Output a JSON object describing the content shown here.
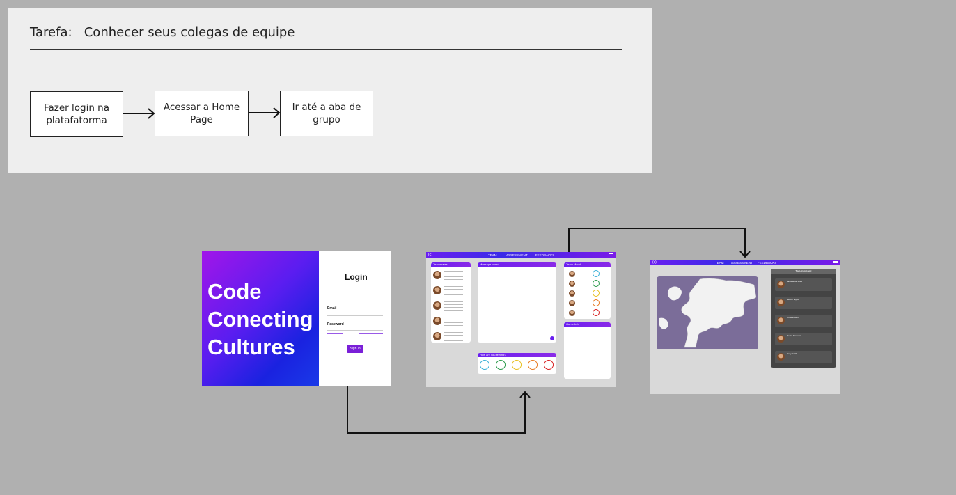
{
  "task": {
    "label": "Tarefa:",
    "text": "Conhecer seus colegas de equipe"
  },
  "steps": [
    {
      "text": "Fazer login na platafatorma"
    },
    {
      "text": "Acessar a Home Page"
    },
    {
      "text": "Ir até a aba de grupo"
    }
  ],
  "login_screen": {
    "hero_lines": [
      "Code",
      "Conecting",
      "Cultures"
    ],
    "title": "Login",
    "email_label": "Email",
    "password_label": "Password",
    "button_label": "Sign in",
    "colors": {
      "hero_start": "#a116e9",
      "hero_end": "#1a3ae8",
      "button": "#7a1fd8"
    }
  },
  "home_screen": {
    "nav": [
      "TEAM",
      "ASSESSMENT",
      "FEEDBACKS"
    ],
    "cards": {
      "teammates": "Teammates",
      "message_board": "Message board",
      "team_mood": "Team Mood",
      "game_info": "Game Info",
      "feeling": "How are you feeling?"
    },
    "emoji_colors": [
      "#3ab0d8",
      "#2a9a4a",
      "#e8c020",
      "#e87a20",
      "#d82020"
    ]
  },
  "group_screen": {
    "nav": [
      "TEAM",
      "ASSESSMENT",
      "FEEDBACKS"
    ],
    "teammates_title": "Teammates",
    "members": [
      "Jaimine da Silva",
      "Simon Taylor",
      "Chris Wilson",
      "Pedro Proença",
      "Tony Smith"
    ]
  }
}
